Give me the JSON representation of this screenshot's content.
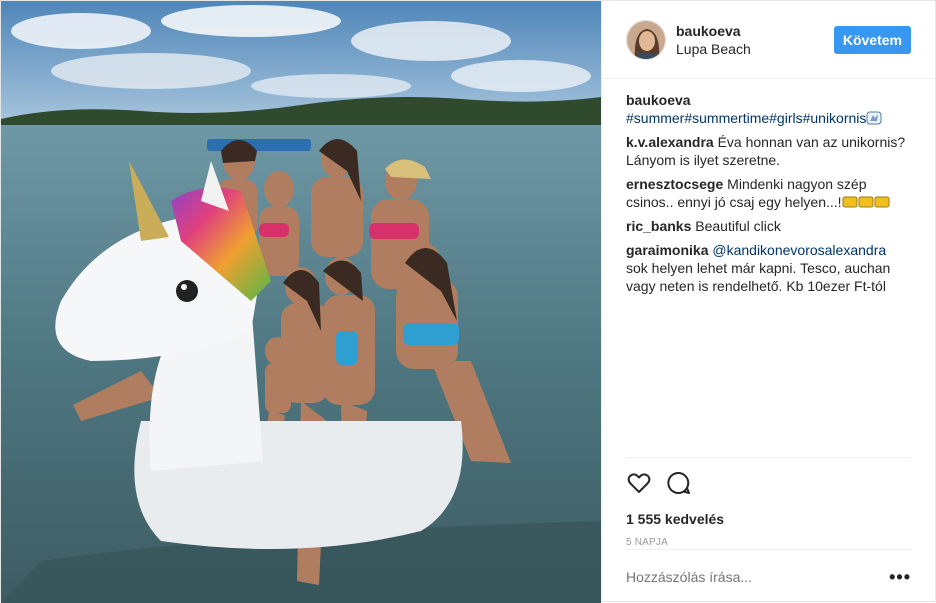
{
  "header": {
    "username": "baukoeva",
    "location": "Lupa Beach",
    "follow_label": "Követem"
  },
  "caption": {
    "username": "baukoeva",
    "text": "#summer#summertime#girls#unikornis"
  },
  "comments": [
    {
      "username": "k.v.alexandra",
      "text": "Éva honnan van az unikornis? Lányom is ilyet szeretne."
    },
    {
      "username": "ernesztocsege",
      "text": "Mindenki nagyon szép csinos.. ennyi jó csaj egy helyen...!"
    },
    {
      "username": "ric_banks",
      "text": "Beautiful click"
    },
    {
      "username": "garaimonika",
      "mention": "@kandikonevorosalexandra",
      "text": " sok helyen lehet már kapni. Tesco, auchan vagy neten is rendelhető. Kb 10ezer Ft-tól"
    }
  ],
  "actions": {
    "like_icon": "heart-icon",
    "comment_icon": "speech-bubble-icon"
  },
  "likes": "1 555 kedvelés",
  "time_ago": "5 NAPJA",
  "comment_box": {
    "placeholder": "Hozzászólás írása...",
    "more_label": "•••"
  },
  "colors": {
    "follow_button": "#3897f0",
    "hashtag": "#003569",
    "muted": "#999999"
  }
}
